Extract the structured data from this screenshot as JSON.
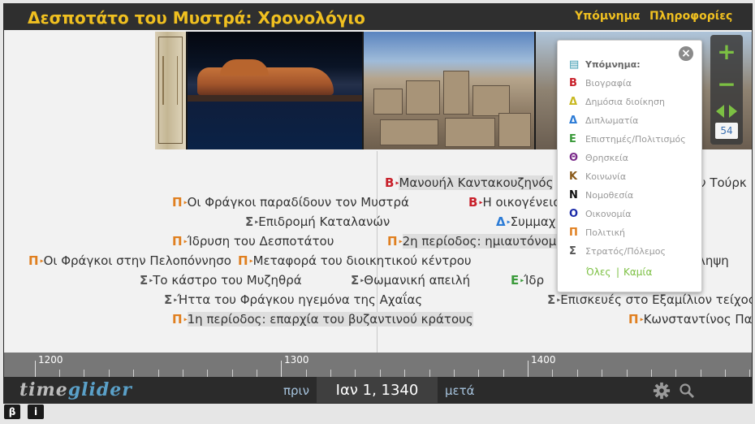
{
  "header": {
    "title": "Δεσποτάτο του Μυστρά: Χρονολόγιο",
    "legend_link": "Υπόμνημα",
    "info_link": "Πληροφορίες"
  },
  "events": [
    {
      "cat": "bio",
      "icon": "Β",
      "text": "Μανουήλ Καντακουζηνός",
      "span": true
    },
    {
      "cat": "pol",
      "icon": "Π",
      "text": "Οι Φράγκοι παραδίδουν τον Μυστρά"
    },
    {
      "cat": "bio",
      "icon": "Β",
      "text": "Η οικογένεια"
    },
    {
      "cat": "mil",
      "icon": "Σ",
      "text": "Επιδρομή Καταλανών"
    },
    {
      "cat": "dip",
      "icon": "Δ",
      "text": "Συμμαχ"
    },
    {
      "cat": "pol",
      "icon": "Π",
      "text": "Ίδρυση του Δεσποτάτου"
    },
    {
      "cat": "pol",
      "icon": "Π",
      "text": "2η περίοδος: ημιαυτόνομο",
      "span": true
    },
    {
      "cat": "pol",
      "icon": "Π",
      "text": "Οι Φράγκοι στην Πελοπόννησο"
    },
    {
      "cat": "pol",
      "icon": "Π",
      "text": "Μεταφορά του διοικητικού κέντρου"
    },
    {
      "cat": "mil",
      "icon": "Σ",
      "text": "Το κάστρο του Μυζηθρά"
    },
    {
      "cat": "mil",
      "icon": "Σ",
      "text": "Θωμανική απειλή"
    },
    {
      "cat": "sci",
      "icon": "Ε",
      "text": "Ίδρ"
    },
    {
      "cat": "mil",
      "icon": "Σ",
      "text": "Ήττα του Φράγκου ηγεμόνα της Αχαΐας"
    },
    {
      "cat": "mil",
      "icon": "Σ",
      "text": "Επισκευές στο Εξαμίλιον τείχος"
    },
    {
      "cat": "pol",
      "icon": "Π",
      "text": "1η περίοδος: επαρχία του βυζαντινού κράτους",
      "span": true
    },
    {
      "cat": "pol",
      "icon": "Π",
      "text": "Κωνσταντίνος Παλ"
    },
    {
      "cat": "other",
      "icon": "",
      "text": "ον Τούρκ"
    },
    {
      "cat": "other",
      "icon": "",
      "text": "ληψη"
    }
  ],
  "ruler": {
    "labels": [
      "1200",
      "1300",
      "1400"
    ]
  },
  "footer": {
    "logo_a": "time",
    "logo_b": "glider",
    "prev": "πριν",
    "date": "Ιαν 1, 1340",
    "next": "μετά"
  },
  "zoom": {
    "level": "54"
  },
  "legend": {
    "header": "Υπόμνημα:",
    "items": [
      {
        "cat": "bio",
        "icon": "Β",
        "label": "Βιογραφία"
      },
      {
        "cat": "pub",
        "icon": "Δ",
        "label": "Δημόσια διοίκηση"
      },
      {
        "cat": "dip",
        "icon": "Δ",
        "label": "Διπλωματία"
      },
      {
        "cat": "sci",
        "icon": "Ε",
        "label": "Επιστημές/Πολιτισμός"
      },
      {
        "cat": "rel",
        "icon": "Θ",
        "label": "Θρησκεία"
      },
      {
        "cat": "soc",
        "icon": "Κ",
        "label": "Κοινωνία"
      },
      {
        "cat": "law",
        "icon": "Ν",
        "label": "Νομοθεσία"
      },
      {
        "cat": "eco",
        "icon": "Ο",
        "label": "Οικονομία"
      },
      {
        "cat": "pol",
        "icon": "Π",
        "label": "Πολιτική"
      },
      {
        "cat": "mil",
        "icon": "Σ",
        "label": "Στρατός/Πόλεμος"
      }
    ],
    "all": "Όλες",
    "sep": "|",
    "none": "Καμία"
  },
  "corner": {
    "b": "β",
    "i": "i"
  },
  "colors": {
    "title": "#f0c020",
    "accent": "#7cc043",
    "pol": "#e07f1f",
    "bio": "#c8202a",
    "dip": "#2b7bd6",
    "sci": "#3a9a3a"
  }
}
